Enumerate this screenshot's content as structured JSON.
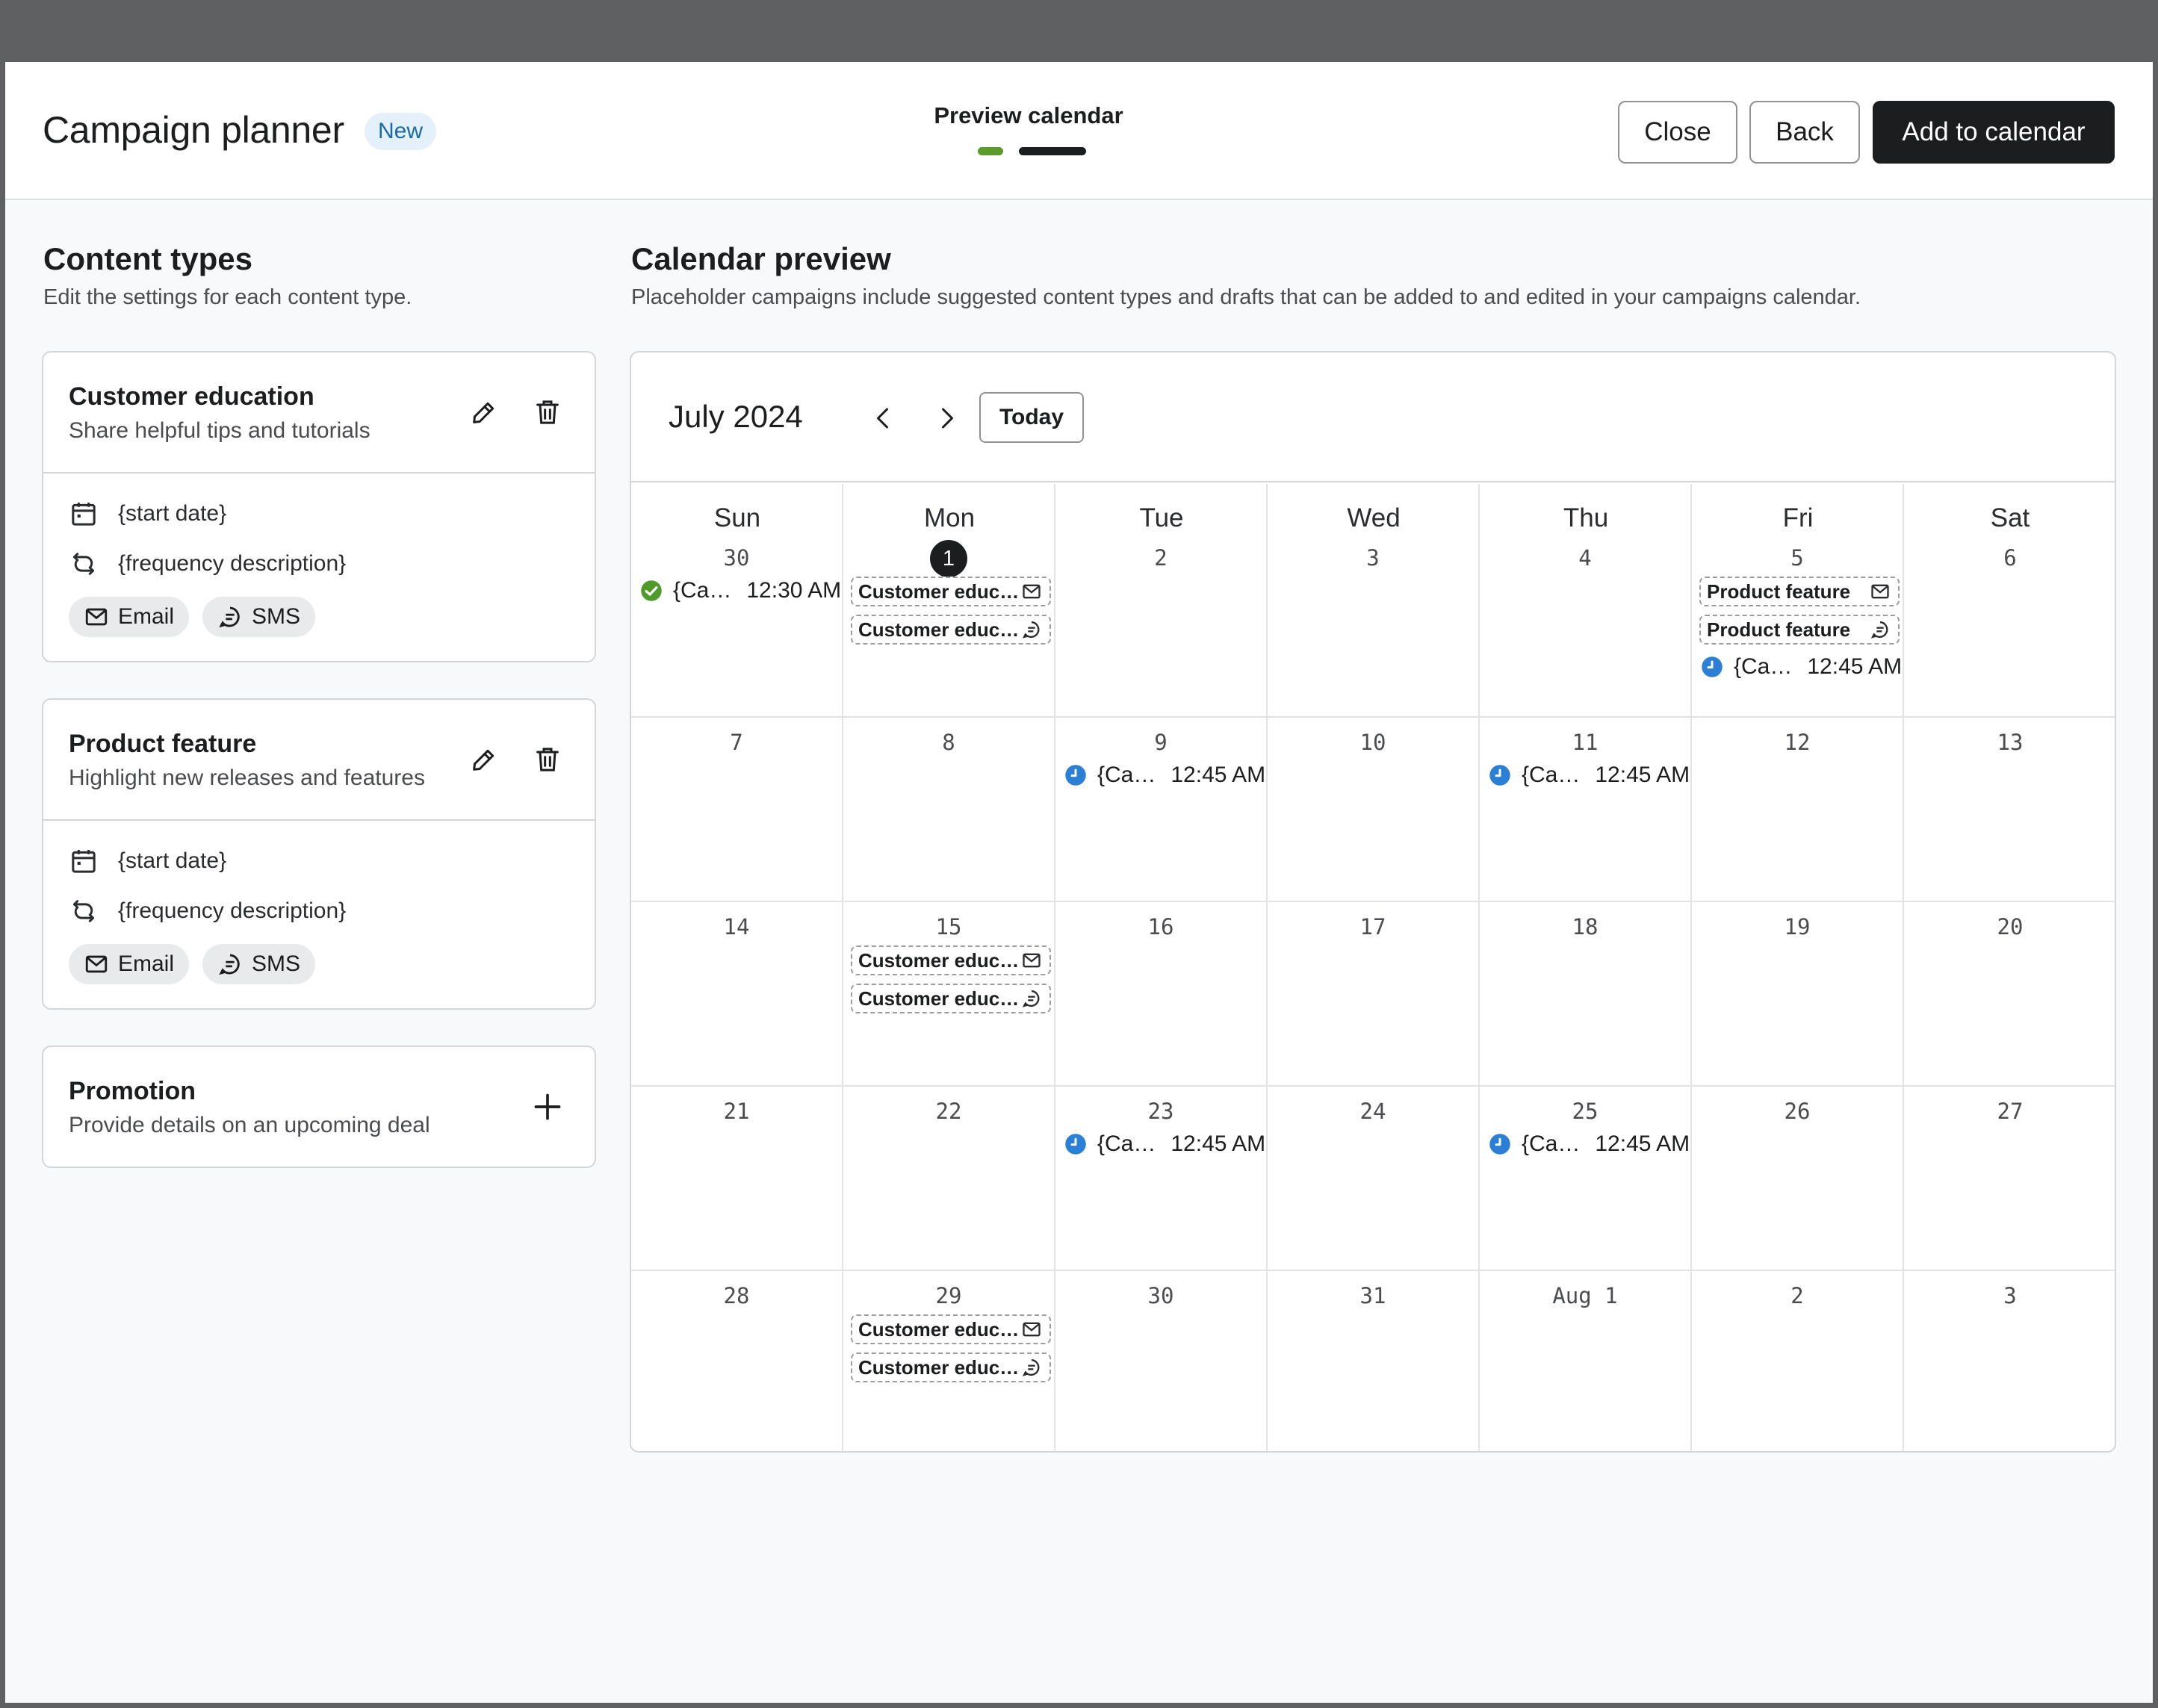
{
  "header": {
    "title": "Campaign planner",
    "badge": "New",
    "step_label": "Preview calendar",
    "close_label": "Close",
    "back_label": "Back",
    "add_label": "Add to calendar"
  },
  "content_types": {
    "title": "Content types",
    "subtitle": "Edit the settings for each content type.",
    "cards": [
      {
        "title": "Customer education",
        "description": "Share helpful tips and tutorials",
        "start_date": "{start date}",
        "frequency": "{frequency description}",
        "channels": [
          "Email",
          "SMS"
        ]
      },
      {
        "title": "Product feature",
        "description": "Highlight new releases and features",
        "start_date": "{start date}",
        "frequency": "{frequency description}",
        "channels": [
          "Email",
          "SMS"
        ]
      },
      {
        "title": "Promotion",
        "description": "Provide details on an upcoming deal"
      }
    ]
  },
  "calendar": {
    "title": "Calendar preview",
    "subtitle": "Placeholder campaigns include suggested content types and drafts that can be added to and edited in your campaigns calendar.",
    "month": "July 2024",
    "today_label": "Today",
    "weekdays": [
      "Sun",
      "Mon",
      "Tue",
      "Wed",
      "Thu",
      "Fri",
      "Sat"
    ],
    "weeks": [
      [
        "30",
        "1",
        "2",
        "3",
        "4",
        "5",
        "6"
      ],
      [
        "7",
        "8",
        "9",
        "10",
        "11",
        "12",
        "13"
      ],
      [
        "14",
        "15",
        "16",
        "17",
        "18",
        "19",
        "20"
      ],
      [
        "21",
        "22",
        "23",
        "24",
        "25",
        "26",
        "27"
      ],
      [
        "28",
        "29",
        "30",
        "31",
        "Aug 1",
        "2",
        "3"
      ]
    ],
    "events": {
      "sent": {
        "name": "{Ca…",
        "time": "12:30 AM"
      },
      "scheduled": {
        "name": "{Ca…",
        "time": "12:45 AM"
      },
      "edu_tag": "Customer educ…",
      "product_tag": "Product feature"
    },
    "colors": {
      "sent": "#4e9a2b",
      "scheduled": "#2b7fd4",
      "accent": "#1c1d1f"
    }
  }
}
